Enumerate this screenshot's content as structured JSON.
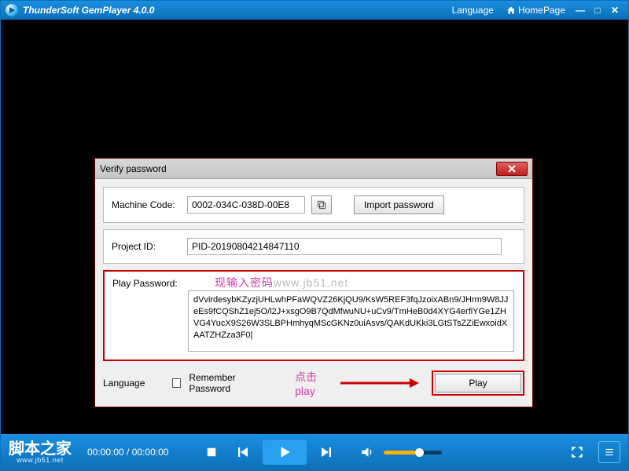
{
  "titlebar": {
    "app_title": "ThunderSoft GemPlayer 4.0.0",
    "language_link": "Language",
    "homepage_link": "HomePage"
  },
  "dialog": {
    "title": "Verify password",
    "machine_code_label": "Machine Code:",
    "machine_code_value": "0002-034C-038D-00E8",
    "import_password_btn": "Import password",
    "project_id_label": "Project ID:",
    "project_id_value": "PID-20190804214847110",
    "play_password_label": "Play Password:",
    "watermark_cn": "现输入密码",
    "watermark_grey": "www.jb51.net",
    "password_value": "dVvirdesybKZyzjUHLwhPFaWQVZ26KjQU9/KsW5REF3fqJzoixABn9/JHrm9W8JJeEs9fCQShZ1ej5O/l2J+xsgO9B7QdMfwuNU+uCv9/TmHeB0d4XYG4erfiYGe1ZHVG4YucX9S26W3SLBPHmhyqMScGKNz0uiAsvs/QAKdUKki3LGtSTsZZiEwxoidXAATZHZza3F0|",
    "language_label": "Language",
    "remember_label": "Remember Password",
    "annotation": "点击play",
    "play_btn": "Play"
  },
  "controls": {
    "brand_cn": "脚本之家",
    "brand_url": "www.jb51.net",
    "time": "00:00:00 / 00:00:00"
  }
}
